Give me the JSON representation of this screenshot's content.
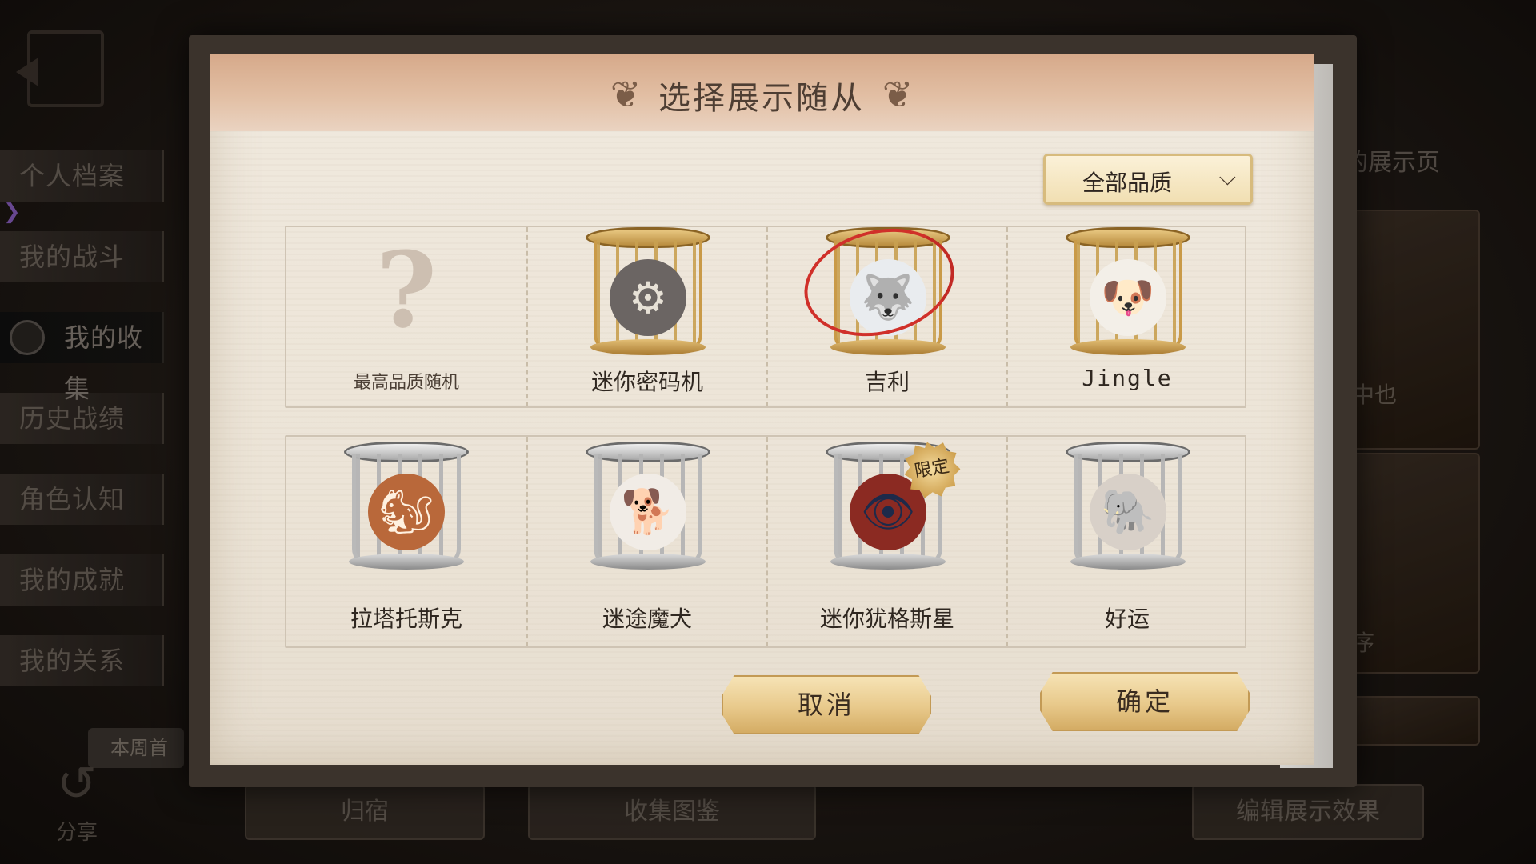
{
  "background": {
    "side_nav": [
      {
        "label": "个人档案",
        "active": false
      },
      {
        "label": "我的战斗",
        "active": false
      },
      {
        "label": "我的收集",
        "active": true
      },
      {
        "label": "历史战绩",
        "active": false
      },
      {
        "label": "角色认知",
        "active": false
      },
      {
        "label": "我的成就",
        "active": false
      },
      {
        "label": "我的关系",
        "active": false
      }
    ],
    "week_first": "本周首",
    "share": "分享",
    "bottom_buttons": [
      "归宿",
      "收集图鉴",
      "编辑展示效果"
    ],
    "right_title": "的展示页",
    "right_texts": [
      "中也",
      "序"
    ]
  },
  "modal": {
    "title": "选择展示随从",
    "quality_filter": "全部品质",
    "pets": [
      {
        "name": "最高品质随机",
        "cage": "none",
        "emoji": "?",
        "limited": false,
        "selected": false
      },
      {
        "name": "迷你密码机",
        "cage": "gold",
        "emoji": "⚙",
        "limited": false,
        "selected": false
      },
      {
        "name": "吉利",
        "cage": "gold",
        "emoji": "🐺",
        "limited": false,
        "selected": true
      },
      {
        "name": "Jingle",
        "cage": "gold",
        "emoji": "🐶",
        "limited": false,
        "selected": false
      },
      {
        "name": "拉塔托斯克",
        "cage": "silver",
        "emoji": "🐿",
        "limited": false,
        "selected": false
      },
      {
        "name": "迷途魔犬",
        "cage": "silver",
        "emoji": "🐕",
        "limited": false,
        "selected": false
      },
      {
        "name": "迷你犹格斯星",
        "cage": "silver",
        "emoji": "👁",
        "limited": true,
        "selected": false
      },
      {
        "name": "好运",
        "cage": "silver",
        "emoji": "🐘",
        "limited": false,
        "selected": false
      }
    ],
    "limited_label": "限定",
    "cancel_label": "取消",
    "confirm_label": "确定"
  },
  "colors": {
    "header": "#d6a98a",
    "paper": "#ece4d7",
    "button_gold": "#e8c98b",
    "selection_ring": "#d0302a"
  }
}
